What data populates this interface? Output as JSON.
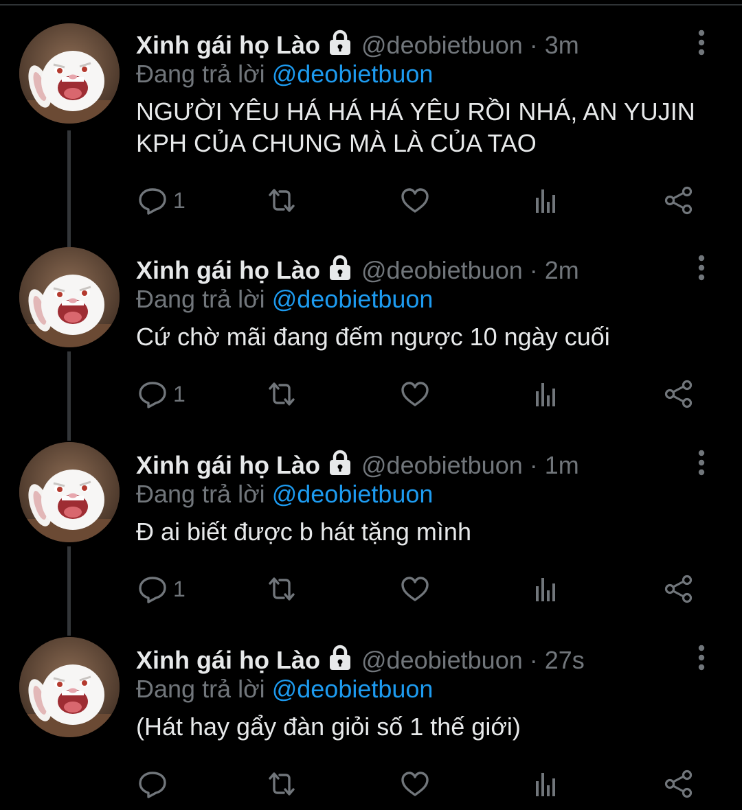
{
  "colors": {
    "background": "#000000",
    "text": "#e7e9ea",
    "secondary": "#71767b",
    "accent": "#1d9bf0",
    "thread_line": "#333639"
  },
  "tweets": [
    {
      "name": "Xinh gái họ Lào",
      "handle": "@deobietbuon",
      "separator": "·",
      "time": "3m",
      "reply_prefix": "Đang trả lời",
      "reply_to": "@deobietbuon",
      "text": "NGƯỜI YÊU HÁ HÁ HÁ YÊU RỒI NHÁ, AN YUJIN KPH CỦA CHUNG MÀ LÀ CỦA TAO",
      "reply_count": "1",
      "icons": [
        "lock-icon",
        "more-icon",
        "reply-icon",
        "retweet-icon",
        "like-icon",
        "analytics-icon",
        "share-icon"
      ]
    },
    {
      "name": "Xinh gái họ Lào",
      "handle": "@deobietbuon",
      "separator": "·",
      "time": "2m",
      "reply_prefix": "Đang trả lời",
      "reply_to": "@deobietbuon",
      "text": "Cứ chờ mãi đang đếm ngược 10 ngày cuối",
      "reply_count": "1",
      "icons": [
        "lock-icon",
        "more-icon",
        "reply-icon",
        "retweet-icon",
        "like-icon",
        "analytics-icon",
        "share-icon"
      ]
    },
    {
      "name": "Xinh gái họ Lào",
      "handle": "@deobietbuon",
      "separator": "·",
      "time": "1m",
      "reply_prefix": "Đang trả lời",
      "reply_to": "@deobietbuon",
      "text": "Đ ai biết được b hát tặng mình",
      "reply_count": "1",
      "icons": [
        "lock-icon",
        "more-icon",
        "reply-icon",
        "retweet-icon",
        "like-icon",
        "analytics-icon",
        "share-icon"
      ]
    },
    {
      "name": "Xinh gái họ Lào",
      "handle": "@deobietbuon",
      "separator": "·",
      "time": "27s",
      "reply_prefix": "Đang trả lời",
      "reply_to": "@deobietbuon",
      "text": "(Hát hay gẩy đàn giỏi số 1 thế giới)",
      "reply_count": "",
      "icons": [
        "lock-icon",
        "more-icon",
        "reply-icon",
        "retweet-icon",
        "like-icon",
        "analytics-icon",
        "share-icon"
      ]
    }
  ]
}
